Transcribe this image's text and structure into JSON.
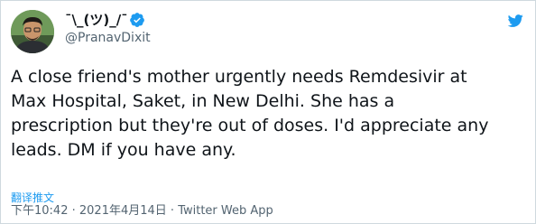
{
  "author": {
    "display_name": "¯\\_(ツ)_/¯",
    "handle": "@PranavDixit",
    "verified": true
  },
  "tweet": {
    "text": "A close friend's mother urgently needs Remdesivir at\nMax Hospital, Saket, in New Delhi. She has a\nprescription but they're out of doses. I'd appreciate any\nleads. DM if you have any.",
    "translate_label": "翻译推文"
  },
  "meta": {
    "time": "下午10:42",
    "separator_1": " · ",
    "date": "2021年4月14日",
    "separator_2": " · ",
    "source": "Twitter Web App"
  },
  "colors": {
    "accent": "#1d9bf0",
    "text_primary": "#0f1419",
    "text_secondary": "#536471",
    "border": "#cfd9de"
  },
  "icons": {
    "verified": "verified-badge-icon",
    "brand": "twitter-bird-icon"
  }
}
